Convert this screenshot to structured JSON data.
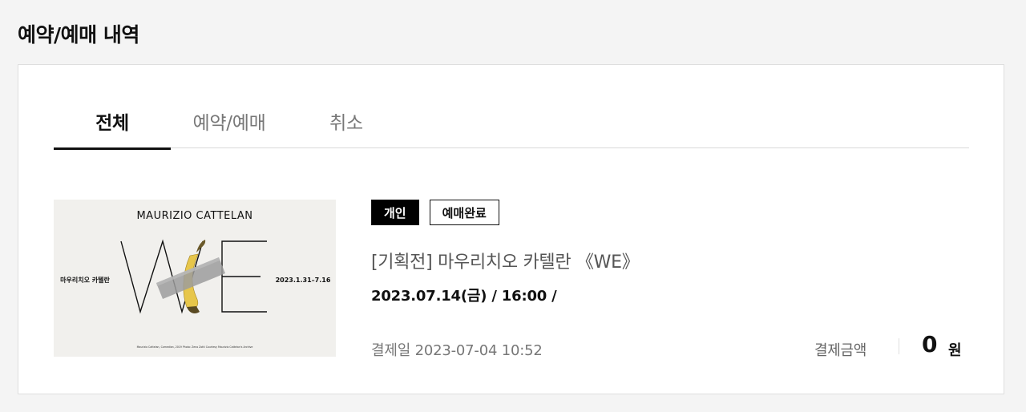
{
  "page": {
    "title": "예약/예매 내역"
  },
  "tabs": [
    {
      "label": "전체",
      "active": true
    },
    {
      "label": "예약/예매",
      "active": false
    },
    {
      "label": "취소",
      "active": false
    }
  ],
  "booking": {
    "poster": {
      "artist": "MAURIZIO CATTELAN",
      "big_text": "WE",
      "korean_name": "마우리치오 카텔란",
      "dates": "2023.1.31–7.16",
      "credit": "Maurizio Cattelan, Comedian, 2019 Photo: Zeno Zotti Courtesy Maurizio Cattelan's Archive"
    },
    "badges": {
      "type": "개인",
      "status": "예매완료"
    },
    "title": "[기획전] 마우리치오 카텔란 《WE》",
    "schedule": "2023.07.14(금) / 16:00 /",
    "paid_date": "결제일 2023-07-04 10:52",
    "amount_label": "결제금액",
    "amount_value": "0",
    "amount_unit": "원"
  },
  "colors": {
    "active_tab_underline": "#111111",
    "badge_dark_bg": "#000000",
    "banana": "#e7c64a",
    "tape": "#9c9c9c"
  }
}
